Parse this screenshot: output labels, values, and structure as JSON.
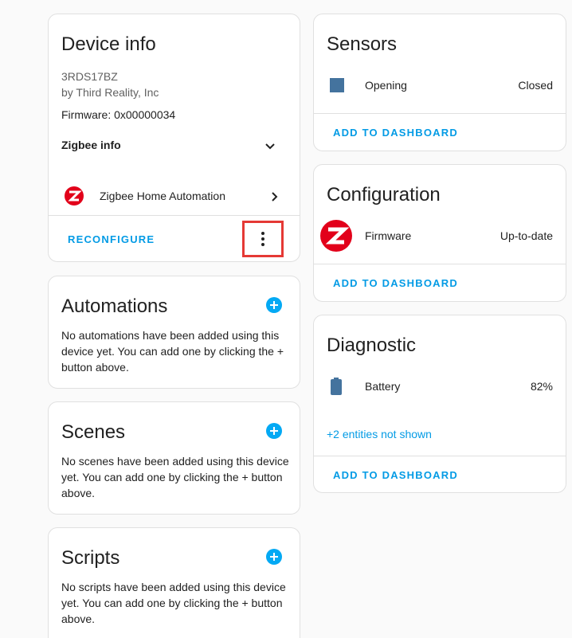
{
  "device_info": {
    "title": "Device info",
    "model": "3RDS17BZ",
    "manufacturer": "by Third Reality, Inc",
    "firmware": "Firmware: 0x00000034",
    "zigbee_info_label": "Zigbee info",
    "integration_label": "Zigbee Home Automation",
    "reconfigure_label": "RECONFIGURE"
  },
  "automations": {
    "title": "Automations",
    "text": "No automations have been added using this device yet. You can add one by clicking the + button above."
  },
  "scenes": {
    "title": "Scenes",
    "text": "No scenes have been added using this device yet. You can add one by clicking the + button above."
  },
  "scripts": {
    "title": "Scripts",
    "text": "No scripts have been added using this device yet. You can add one by clicking the + button above."
  },
  "sensors": {
    "title": "Sensors",
    "entity_label": "Opening",
    "entity_value": "Closed",
    "add_label": "ADD TO DASHBOARD"
  },
  "configuration": {
    "title": "Configuration",
    "entity_label": "Firmware",
    "entity_value": "Up-to-date",
    "add_label": "ADD TO DASHBOARD"
  },
  "diagnostic": {
    "title": "Diagnostic",
    "entity_label": "Battery",
    "entity_value": "82%",
    "hidden_entities": "+2 entities not shown",
    "add_label": "ADD TO DASHBOARD"
  },
  "colors": {
    "accent": "#03a9f4",
    "link": "#039be5",
    "zigbee_red": "#e2001a",
    "highlight_box": "#e53935"
  }
}
